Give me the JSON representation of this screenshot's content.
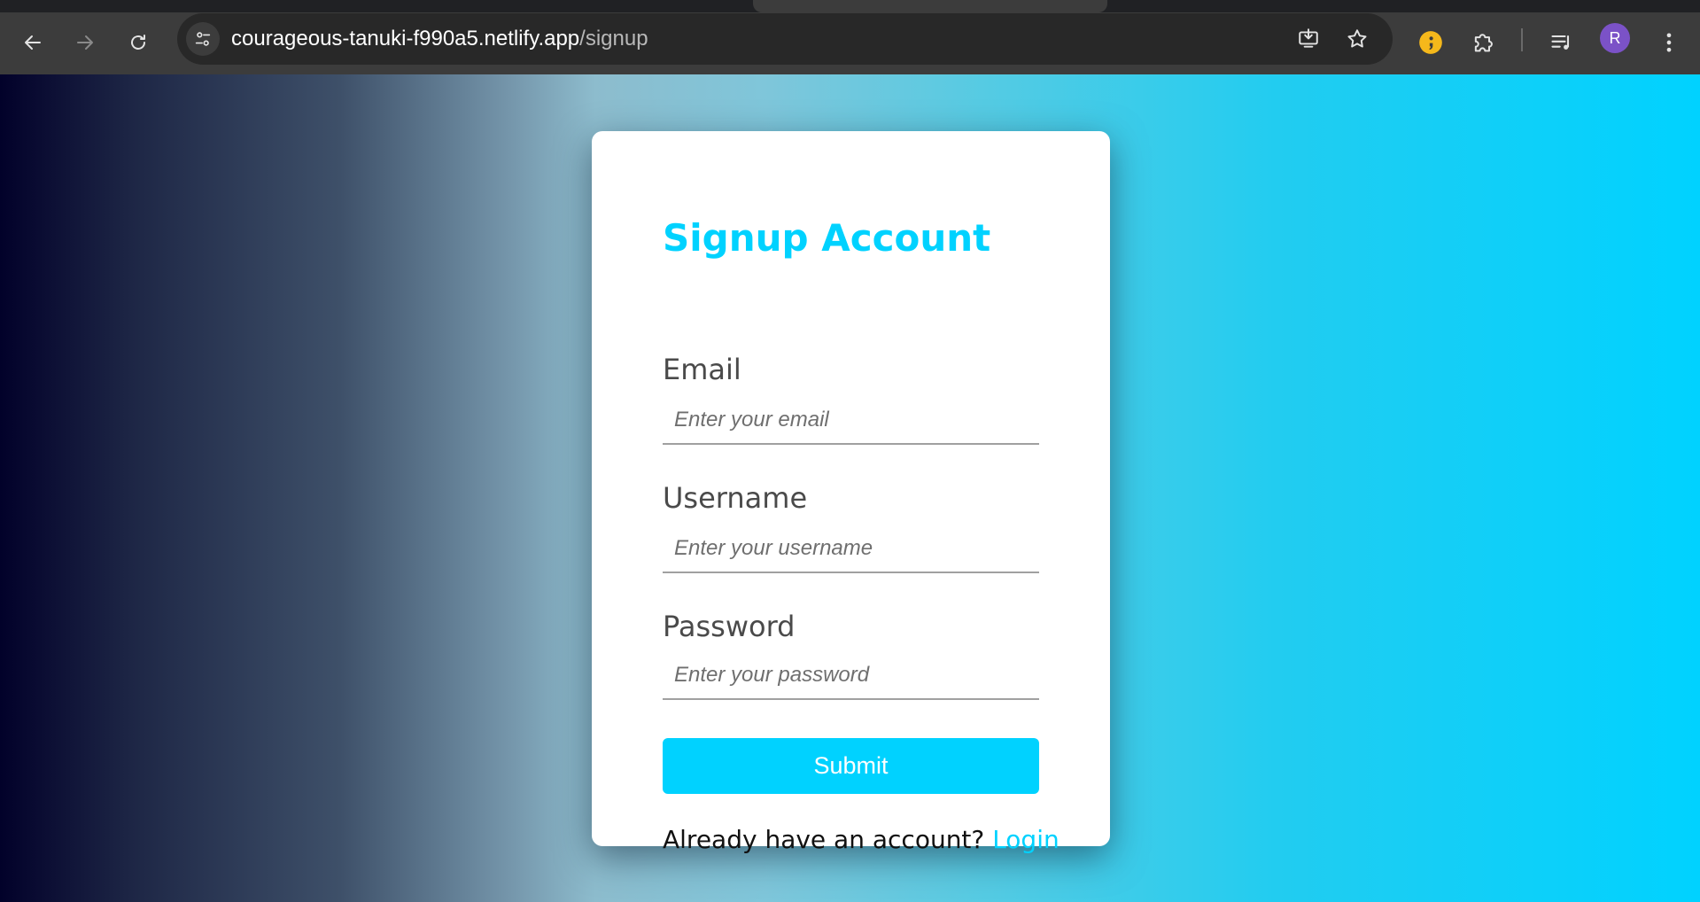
{
  "browser": {
    "url_host": "courageous-tanuki-f990a5.netlify.app",
    "url_path": "/signup",
    "profile_initial": "R",
    "icons": {
      "back": "back-arrow-icon",
      "forward": "forward-arrow-icon",
      "reload": "reload-icon",
      "site_info": "tune-icon",
      "install": "install-app-icon",
      "bookmark": "star-icon",
      "extension_1": "semicolon-extension-icon",
      "extensions": "puzzle-icon",
      "media": "media-queue-icon",
      "menu": "kebab-menu-icon"
    }
  },
  "colors": {
    "accent": "#00d2ff",
    "gradient_start": "#02012a",
    "gradient_end": "#00d2ff",
    "avatar": "#7b52c7",
    "extension_badge": "#f5b81b"
  },
  "signup": {
    "title": "Signup Account",
    "email": {
      "label": "Email",
      "placeholder": "Enter your email",
      "value": ""
    },
    "username": {
      "label": "Username",
      "placeholder": "Enter your username",
      "value": ""
    },
    "password": {
      "label": "Password",
      "placeholder": "Enter your password",
      "value": ""
    },
    "submit_label": "Submit",
    "footer_text": "Already have an account? ",
    "login_link": "Login"
  }
}
